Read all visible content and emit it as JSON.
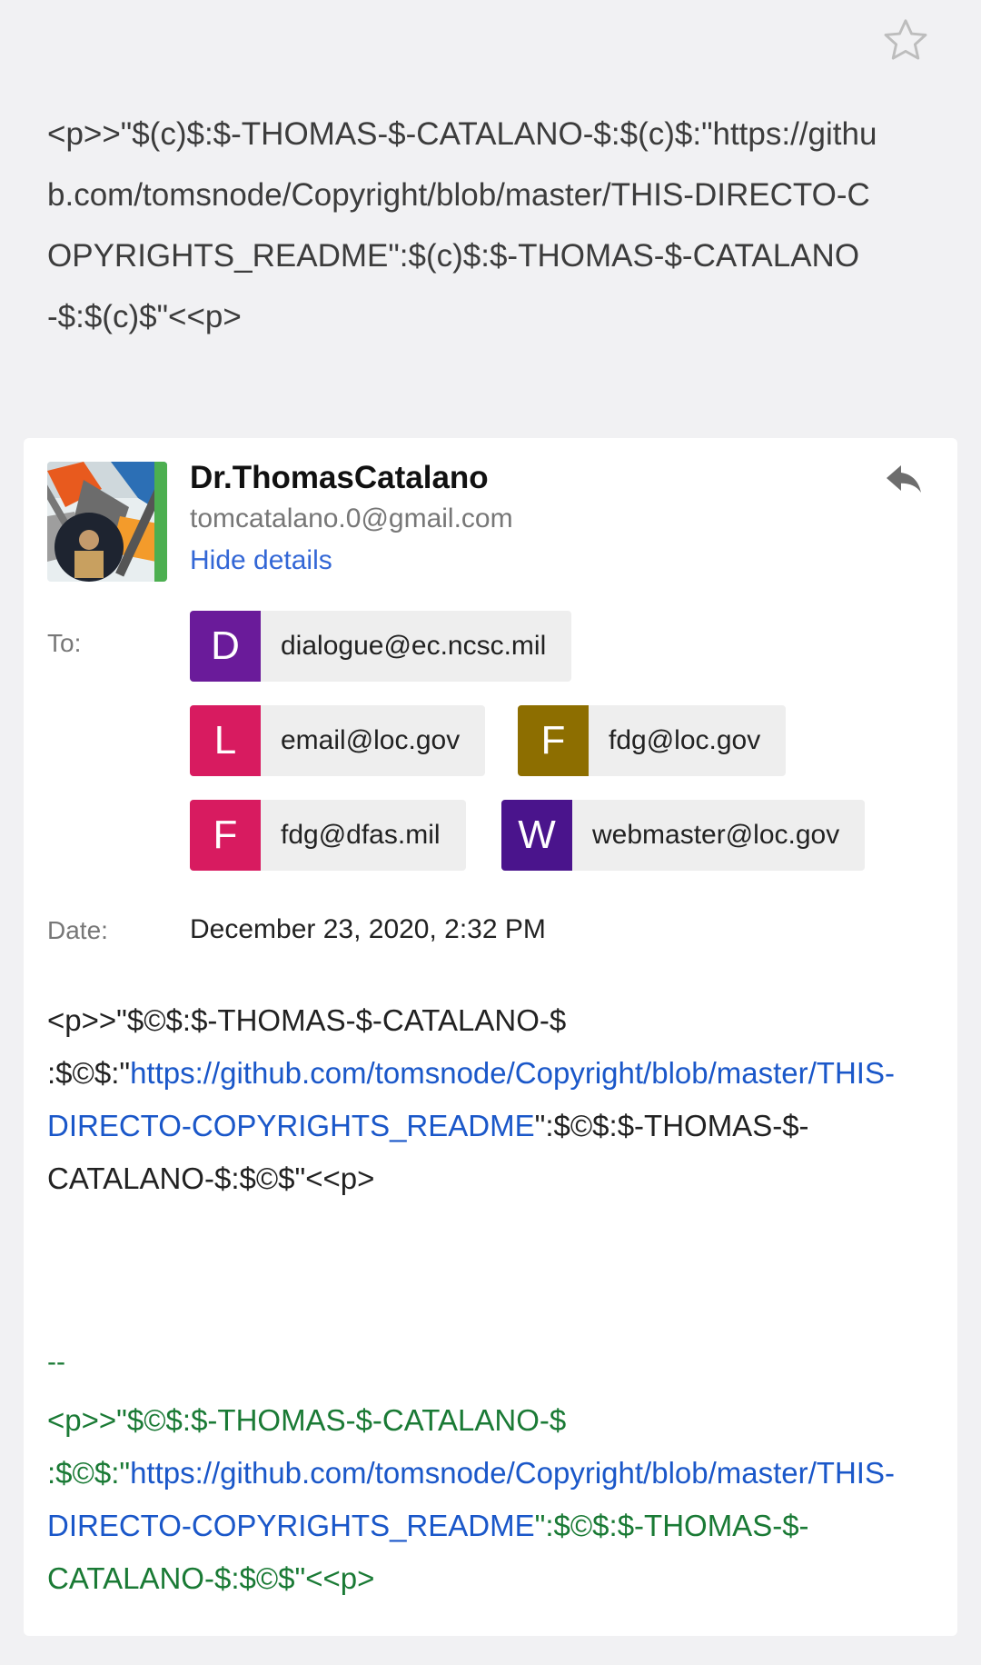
{
  "subject": "<p>>\"$(c)$:$-THOMAS-$-CATALANO-$:$(c)$:\"https://github.com/tomsnode/Copyright/blob/master/THIS-DIRECTO-COPYRIGHTS_README\":$(c)$:$-THOMAS-$-CATALANO-$:$(c)$\"<<p>",
  "sender": {
    "name": "Dr.ThomasCatalano",
    "email": "tomcatalano.0@gmail.com",
    "hide_details": "Hide details"
  },
  "details": {
    "to_label": "To:",
    "recipients": [
      {
        "letter": "D",
        "email": "dialogue@ec.ncsc.mil",
        "color": "#6a1b9a"
      },
      {
        "letter": "L",
        "email": "email@loc.gov",
        "color": "#d81b60"
      },
      {
        "letter": "F",
        "email": "fdg@loc.gov",
        "color": "#8d6e00"
      },
      {
        "letter": "F",
        "email": "fdg@dfas.mil",
        "color": "#d81b60"
      },
      {
        "letter": "W",
        "email": "webmaster@loc.gov",
        "color": "#4a148c"
      }
    ],
    "date_label": "Date:",
    "date_value": "December 23, 2020, 2:32 PM"
  },
  "body": {
    "prefix": "<p>>\"$©$:$-THOMAS-$-CATALANO-$ :$©$:\"",
    "link": "https://github.com/tomsnode/Copyright/blob/master/THIS-DIRECTO-COPYRIGHTS_README",
    "suffix": "\":$©$:$-THOMAS-$-CATALANO-$:$©$\"<<p>"
  },
  "signature": {
    "dash": "--",
    "prefix": "<p>>\"$©$:$-THOMAS-$-CATALANO-$ :$©$:\"",
    "link": "https://github.com/tomsnode/Copyright/blob/master/THIS-DIRECTO-COPYRIGHTS_README",
    "suffix": "\":$©$:$-THOMAS-$-CATALANO-$:$©$\"<<p>"
  },
  "icons": {
    "star": "star-outline-icon",
    "reply": "reply-icon",
    "avatar": "sender-avatar"
  }
}
